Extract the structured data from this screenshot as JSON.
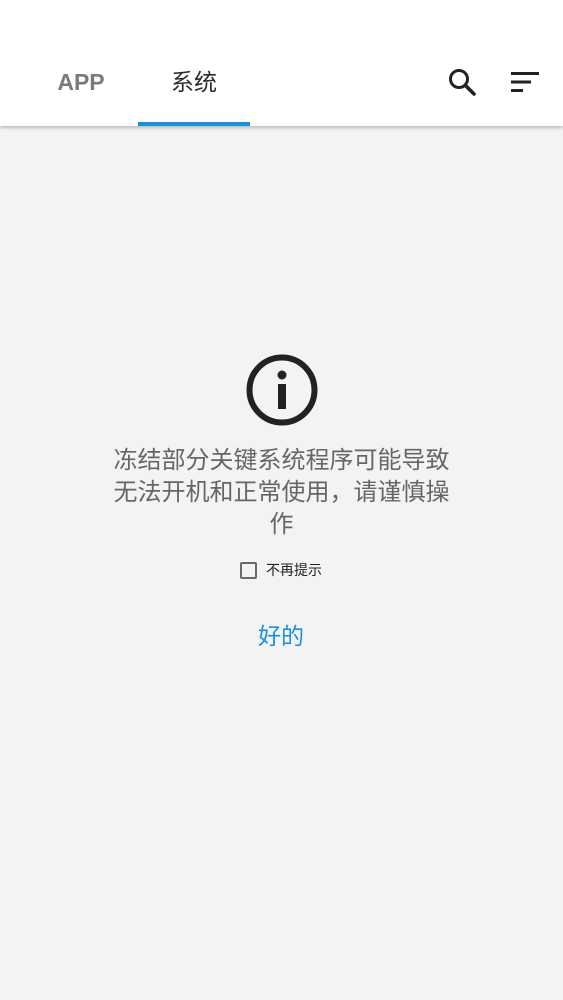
{
  "tabs": [
    {
      "label": "APP",
      "selected": false
    },
    {
      "label": "系统",
      "selected": true
    }
  ],
  "toolbar": {
    "search_icon": "search-icon",
    "sort_icon": "sort-icon"
  },
  "dialog": {
    "icon": "info-icon",
    "message": "冻结部分关键系统程序可能导致无法开机和正常使用，请谨慎操作",
    "checkbox_label": "不再提示",
    "checkbox_checked": false,
    "ok_label": "好的"
  },
  "colors": {
    "accent": "#1a8fdc",
    "background": "#f3f3f3",
    "app_bar": "#ffffff"
  }
}
